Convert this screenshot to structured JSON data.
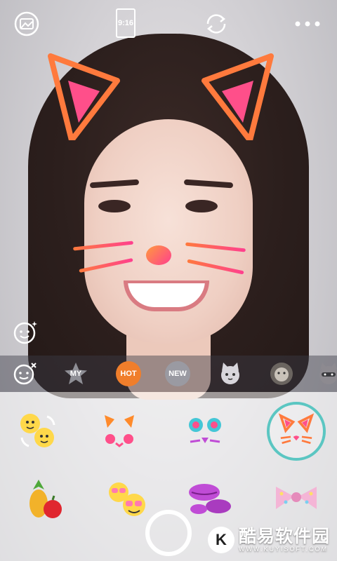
{
  "topbar": {
    "gallery_icon": "gallery-icon",
    "ratio_label": "9:16",
    "switch_camera_icon": "switch-camera-icon",
    "more_icon": "more-icon"
  },
  "beauty": {
    "icon": "beauty-face-icon"
  },
  "categories": [
    {
      "id": "none",
      "icon": "no-sticker-icon"
    },
    {
      "id": "my",
      "label": "MY"
    },
    {
      "id": "hot",
      "label": "HOT",
      "active": true
    },
    {
      "id": "new",
      "label": "NEW"
    },
    {
      "id": "cat",
      "icon": "cat-face-icon"
    },
    {
      "id": "lion",
      "icon": "lion-face-icon"
    },
    {
      "id": "raccoon",
      "icon": "raccoon-face-icon"
    }
  ],
  "stickers": [
    {
      "id": "face-swap",
      "icon": "face-swap-icon"
    },
    {
      "id": "orange-cat",
      "icon": "orange-cat-sticker-icon"
    },
    {
      "id": "blue-cat",
      "icon": "blue-cat-sticker-icon"
    },
    {
      "id": "glitter-cat",
      "icon": "glitter-cat-sticker-icon",
      "selected": true
    },
    {
      "id": "fruit",
      "icon": "fruit-sticker-icon"
    },
    {
      "id": "sunglasses-emoji",
      "icon": "sunglasses-emoji-sticker-icon"
    },
    {
      "id": "kiss",
      "icon": "kiss-lips-sticker-icon"
    },
    {
      "id": "bow",
      "icon": "polka-bow-sticker-icon"
    }
  ],
  "colors": {
    "accent": "#5bc6c2",
    "hot_badge": "#f07e2b"
  },
  "watermark": {
    "logo": "K",
    "title": "酷易软件园",
    "url": "WWW.KUYISOFT.COM"
  }
}
